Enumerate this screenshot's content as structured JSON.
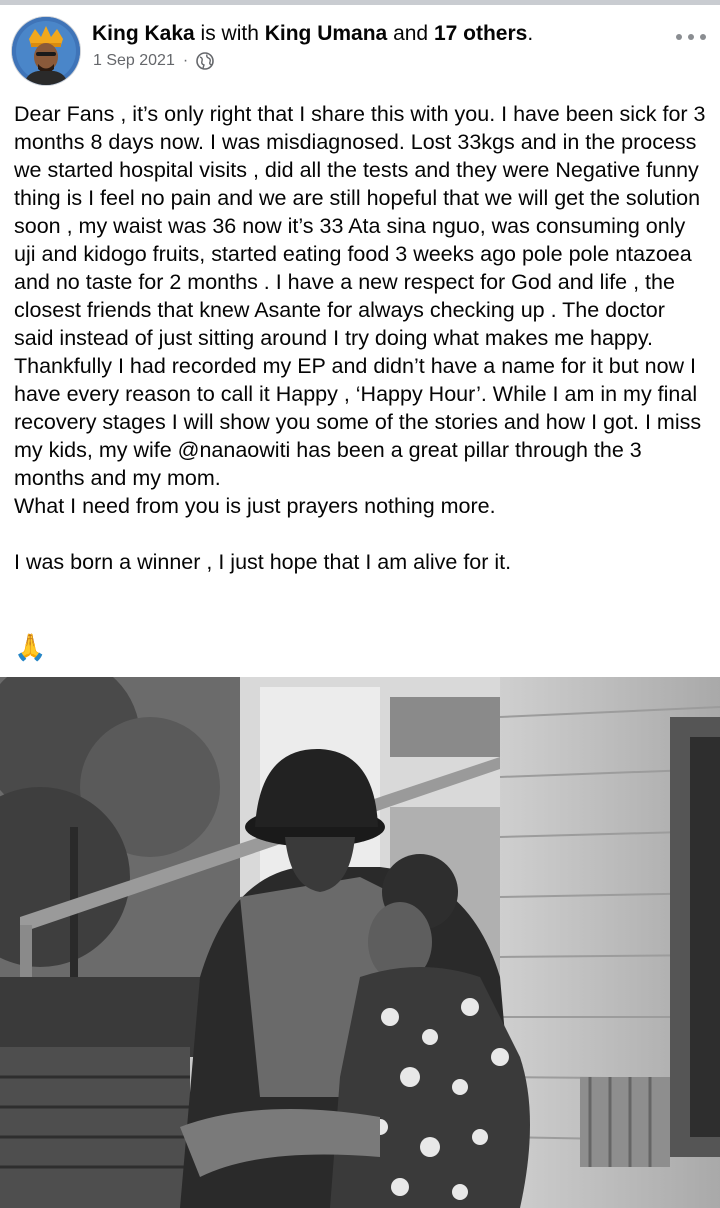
{
  "post": {
    "author": "King Kaka",
    "with_text": " is with ",
    "tagged": "King Umana",
    "and_text": " and ",
    "others": "17 others",
    "period": ".",
    "date": "1 Sep 2021",
    "separator": "·",
    "audience_icon": "globe-icon",
    "body": "Dear Fans , it’s only right that I share this with you. I have been sick for 3 months 8 days now. I was misdiagnosed. Lost 33kgs and in the process we started hospital visits , did all the tests and they were Negative funny thing is I feel no pain and we are still hopeful that we will get the solution soon , my waist was 36 now it’s 33 Ata sina nguo, was consuming only uji and kidogo fruits, started eating food 3 weeks ago pole pole ntazoea and no taste for 2 months . I have a new respect for God and life , the closest friends that knew Asante for always checking up . The doctor said instead of just sitting around I try doing what makes me happy. Thankfully I had recorded my EP and didn’t have a name for it but now I have every reason to call it Happy , ‘Happy Hour’. While I am in my final recovery stages I will show you some of the stories and how I got. I miss my kids, my wife @nanaowiti has been a great pillar through the 3 months and my mom.\nWhat I need from you is just prayers nothing more.\n\nI was born a winner , I just hope that I am alive for it.",
    "emoji": "🙏"
  },
  "colors": {
    "text": "#050505",
    "secondary": "#65676b",
    "divider": "#c9ccd1"
  }
}
